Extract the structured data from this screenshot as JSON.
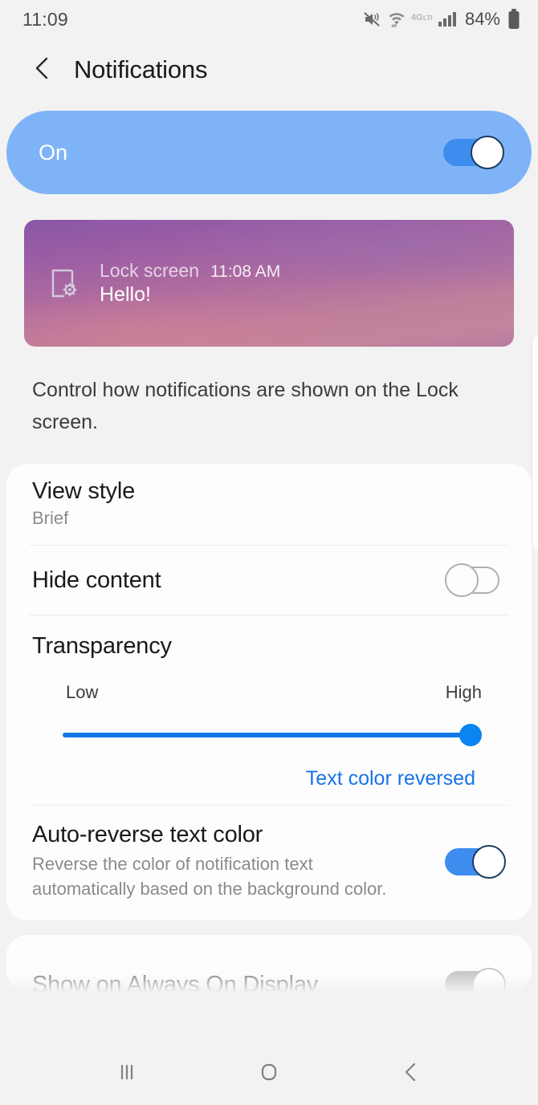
{
  "status_bar": {
    "clock": "11:09",
    "battery_percent": "84%",
    "icons": [
      "mute-vibrate-icon",
      "wifi-icon",
      "lte-4g-icon",
      "cellular-signal-icon",
      "battery-icon"
    ]
  },
  "header": {
    "back_icon": "chevron-left-icon",
    "title": "Notifications"
  },
  "master_switch": {
    "label": "On",
    "state": "on",
    "banner_color": "#7fb3f7",
    "track_color": "#3f8cef"
  },
  "preview": {
    "icon": "device-settings-icon",
    "app_name": "Lock screen",
    "time": "11:08 AM",
    "body": "Hello!",
    "gradient_from": "#8a57a7",
    "gradient_to": "#c2849c"
  },
  "description": "Control how notifications are shown on the Lock screen.",
  "settings": {
    "view_style": {
      "title": "View style",
      "value": "Brief"
    },
    "hide_content": {
      "title": "Hide content",
      "state": "off"
    },
    "transparency": {
      "title": "Transparency",
      "low_label": "Low",
      "high_label": "High",
      "slider_value": 100,
      "slider_min": 0,
      "slider_max": 100,
      "reversed_note": "Text color reversed",
      "accent_color": "#1a73e8"
    },
    "auto_reverse": {
      "title": "Auto-reverse text color",
      "subtitle": "Reverse the color of notification text automatically based on the background color.",
      "state": "on"
    },
    "always_on_display": {
      "title": "Show on Always On Display",
      "state": "on"
    }
  },
  "nav_bar": {
    "recents": "recents-icon",
    "home": "home-icon",
    "back": "back-icon"
  }
}
